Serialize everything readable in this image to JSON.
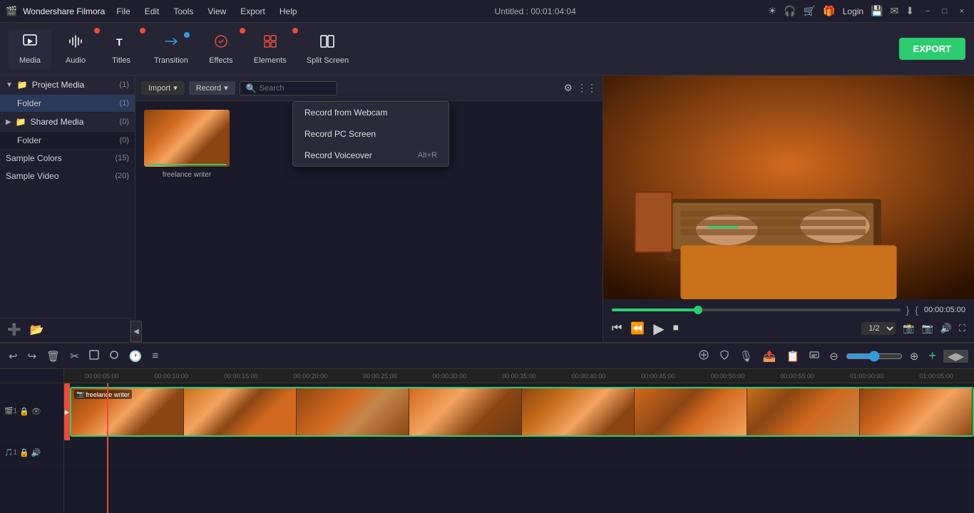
{
  "app": {
    "name": "Wondershare Filmora",
    "title": "Untitled : 00:01:04:04"
  },
  "titlebar": {
    "menus": [
      "File",
      "Edit",
      "Tools",
      "View",
      "Export",
      "Help"
    ],
    "window_controls": [
      "−",
      "□",
      "×"
    ],
    "login_label": "Login"
  },
  "toolbar": {
    "items": [
      {
        "id": "media",
        "label": "Media",
        "icon": "🎬",
        "dot": "none",
        "active": true
      },
      {
        "id": "audio",
        "label": "Audio",
        "icon": "🎵",
        "dot": "red"
      },
      {
        "id": "titles",
        "label": "Titles",
        "icon": "T",
        "dot": "red"
      },
      {
        "id": "transition",
        "label": "Transition",
        "icon": "⟷",
        "dot": "blue"
      },
      {
        "id": "effects",
        "label": "Effects",
        "icon": "✨",
        "dot": "red"
      },
      {
        "id": "elements",
        "label": "Elements",
        "icon": "◈",
        "dot": "red"
      },
      {
        "id": "split_screen",
        "label": "Split Screen",
        "icon": "⊞",
        "dot": "none"
      }
    ],
    "export_label": "EXPORT"
  },
  "sidebar": {
    "sections": [
      {
        "id": "project_media",
        "label": "Project Media",
        "count": "(1)",
        "items": [
          {
            "label": "Folder",
            "count": "(1)",
            "selected": true
          }
        ]
      },
      {
        "id": "shared_media",
        "label": "Shared Media",
        "count": "(0)",
        "items": [
          {
            "label": "Folder",
            "count": "(0)"
          }
        ]
      }
    ],
    "flat_items": [
      {
        "label": "Sample Colors",
        "count": "(15)"
      },
      {
        "label": "Sample Video",
        "count": "(20)"
      }
    ],
    "bottom_icons": [
      "➕",
      "📁"
    ]
  },
  "media_panel": {
    "import_label": "Import",
    "record_label": "Record",
    "search_placeholder": "Search",
    "dropdown": {
      "visible": true,
      "items": [
        {
          "label": "Record from Webcam",
          "shortcut": ""
        },
        {
          "label": "Record PC Screen",
          "shortcut": ""
        },
        {
          "label": "Record Voiceover",
          "shortcut": "Alt+R"
        }
      ]
    },
    "media_items": [
      {
        "label": "freelance writer",
        "has_bar": true
      }
    ]
  },
  "preview": {
    "time_display": "00:00:05:00",
    "progress_percent": 30,
    "quality": "1/2",
    "controls": {
      "prev_frame": "⏮",
      "back": "⏪",
      "play": "▶",
      "stop": "⏹",
      "fullscreen": "⛶"
    }
  },
  "timeline": {
    "toolbar_icons": [
      "↩",
      "↪",
      "🗑",
      "✂",
      "⬛",
      "🔵",
      "🕐",
      "≡"
    ],
    "right_icons": [
      "🔊",
      "🎙",
      "📤",
      "📋",
      "⊖",
      "⊕"
    ],
    "ruler_ticks": [
      "00:00:05:00",
      "00:00:10:00",
      "00:00:15:00",
      "00:00:20:00",
      "00:00:25:00",
      "00:00:30:00",
      "00:00:35:00",
      "00:00:40:00",
      "00:00:45:00",
      "00:00:50:00",
      "00:00:55:00",
      "01:00:00:00",
      "01:00:05:00"
    ],
    "tracks": [
      {
        "id": "video1",
        "icon": "🎬",
        "lock": false,
        "visible": true,
        "label": "freelance writer"
      },
      {
        "id": "audio1",
        "icon": "🎵",
        "lock": false,
        "visible": true,
        "label": ""
      }
    ]
  }
}
